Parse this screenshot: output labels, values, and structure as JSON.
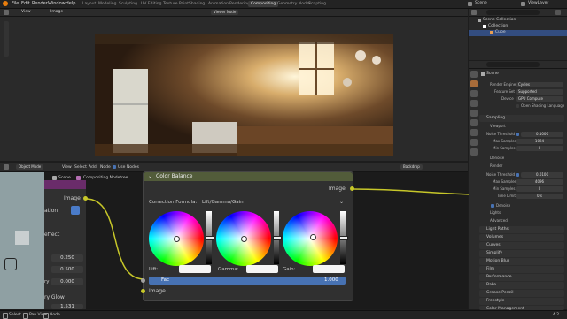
{
  "menubar": {
    "items": [
      "File",
      "Edit",
      "Render",
      "Window",
      "Help"
    ],
    "workspaces": [
      "Layout",
      "Modeling",
      "Sculpting",
      "UV Editing",
      "Texture Paint",
      "Shading",
      "Animation",
      "Rendering",
      "Compositing",
      "Geometry Nodes",
      "Scripting"
    ],
    "active_workspace": "Compositing",
    "scene": "Scene",
    "view_layer": "ViewLayer"
  },
  "image_editor": {
    "view": "View",
    "image": "Image",
    "viewer_node": "Viewer Node"
  },
  "outliner": {
    "scene_collection": "Scene Collection",
    "collection": "Collection",
    "cube": "Cube"
  },
  "properties": {
    "scene_label": "Scene",
    "render_engine_label": "Render Engine",
    "render_engine": "Cycles",
    "feature_set_label": "Feature Set",
    "feature_set": "Supported",
    "device_label": "Device",
    "device": "GPU Compute",
    "osl_label": "Open Shading Language",
    "sampling": "Sampling",
    "viewport": "Viewport",
    "noise_threshold_label": "Noise Threshold",
    "vp_noise_threshold": "0.1000",
    "max_samples_label": "Max Samples",
    "vp_max_samples": "1024",
    "min_samples_label": "Min Samples",
    "vp_min_samples": "0",
    "denoise": "Denoise",
    "render": "Render",
    "r_noise_threshold": "0.0100",
    "r_max_samples": "4096",
    "r_min_samples": "0",
    "time_limit_label": "Time Limit",
    "time_limit": "0 s",
    "denoise2": "Denoise",
    "lights": "Lights",
    "advanced": "Advanced",
    "sections": [
      "Light Paths",
      "Volumes",
      "Curves",
      "Simplify",
      "Motion Blur",
      "Film",
      "Performance",
      "Bake",
      "Grease Pencil",
      "Freestyle",
      "Color Management"
    ]
  },
  "node_editor": {
    "mode": "Object Mode",
    "menus": [
      "View",
      "Select",
      "Add",
      "Node"
    ],
    "use_nodes": "Use Nodes",
    "backdrop": "Backdrop",
    "scene": "Scene",
    "nodetree": "Compositing Nodetree"
  },
  "left_panel": {
    "ation": "ation",
    "effect": "effect",
    "v1": "0.250",
    "v2": "0.500",
    "ry_label": "ry",
    "v3": "0.000",
    "glow": "ry Glow",
    "v4": "1.531",
    "image": "Image"
  },
  "color_balance": {
    "title": "Color Balance",
    "output": "Image",
    "formula_label": "Correction Formula:",
    "formula": "Lift/Gamma/Gain",
    "lift": "Lift:",
    "gamma": "Gamma:",
    "gain": "Gain:",
    "fac_label": "Fac",
    "fac": "1.000",
    "input": "Image"
  },
  "statusbar": {
    "select": "Select",
    "pan": "Pan View",
    "node": "Node",
    "version": "4.2"
  }
}
